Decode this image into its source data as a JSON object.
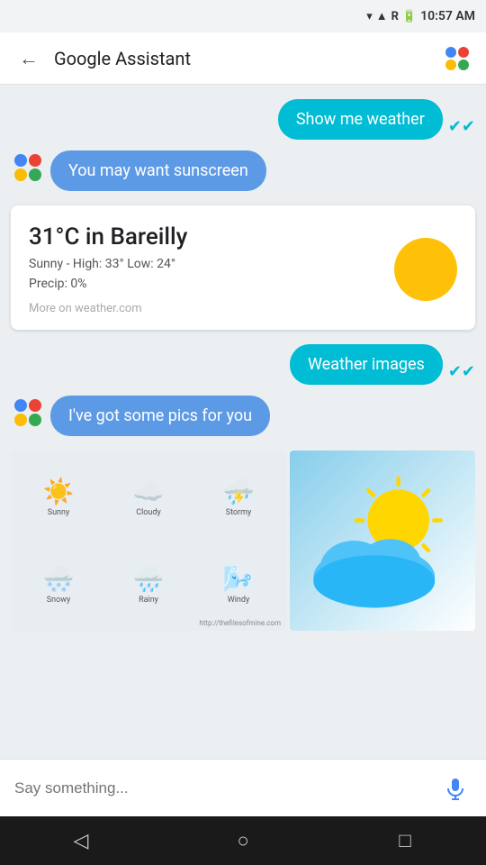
{
  "statusBar": {
    "time": "10:57 AM",
    "icons": [
      "wifi",
      "signal",
      "battery"
    ]
  },
  "header": {
    "title": "Google Assistant",
    "backLabel": "←"
  },
  "chat": {
    "userMsg1": "Show me weather",
    "assistantMsg1": "You may want sunscreen",
    "weatherCard": {
      "temp": "31°C in Bareilly",
      "line1": "Sunny - High: 33° Low: 24°",
      "line2": "Precip: 0%",
      "source": "More on weather.com"
    },
    "userMsg2": "Weather images",
    "assistantMsg2": "I've got some pics for you"
  },
  "inputBar": {
    "placeholder": "Say something..."
  },
  "nav": {
    "back": "◁",
    "home": "○",
    "recents": "□"
  }
}
